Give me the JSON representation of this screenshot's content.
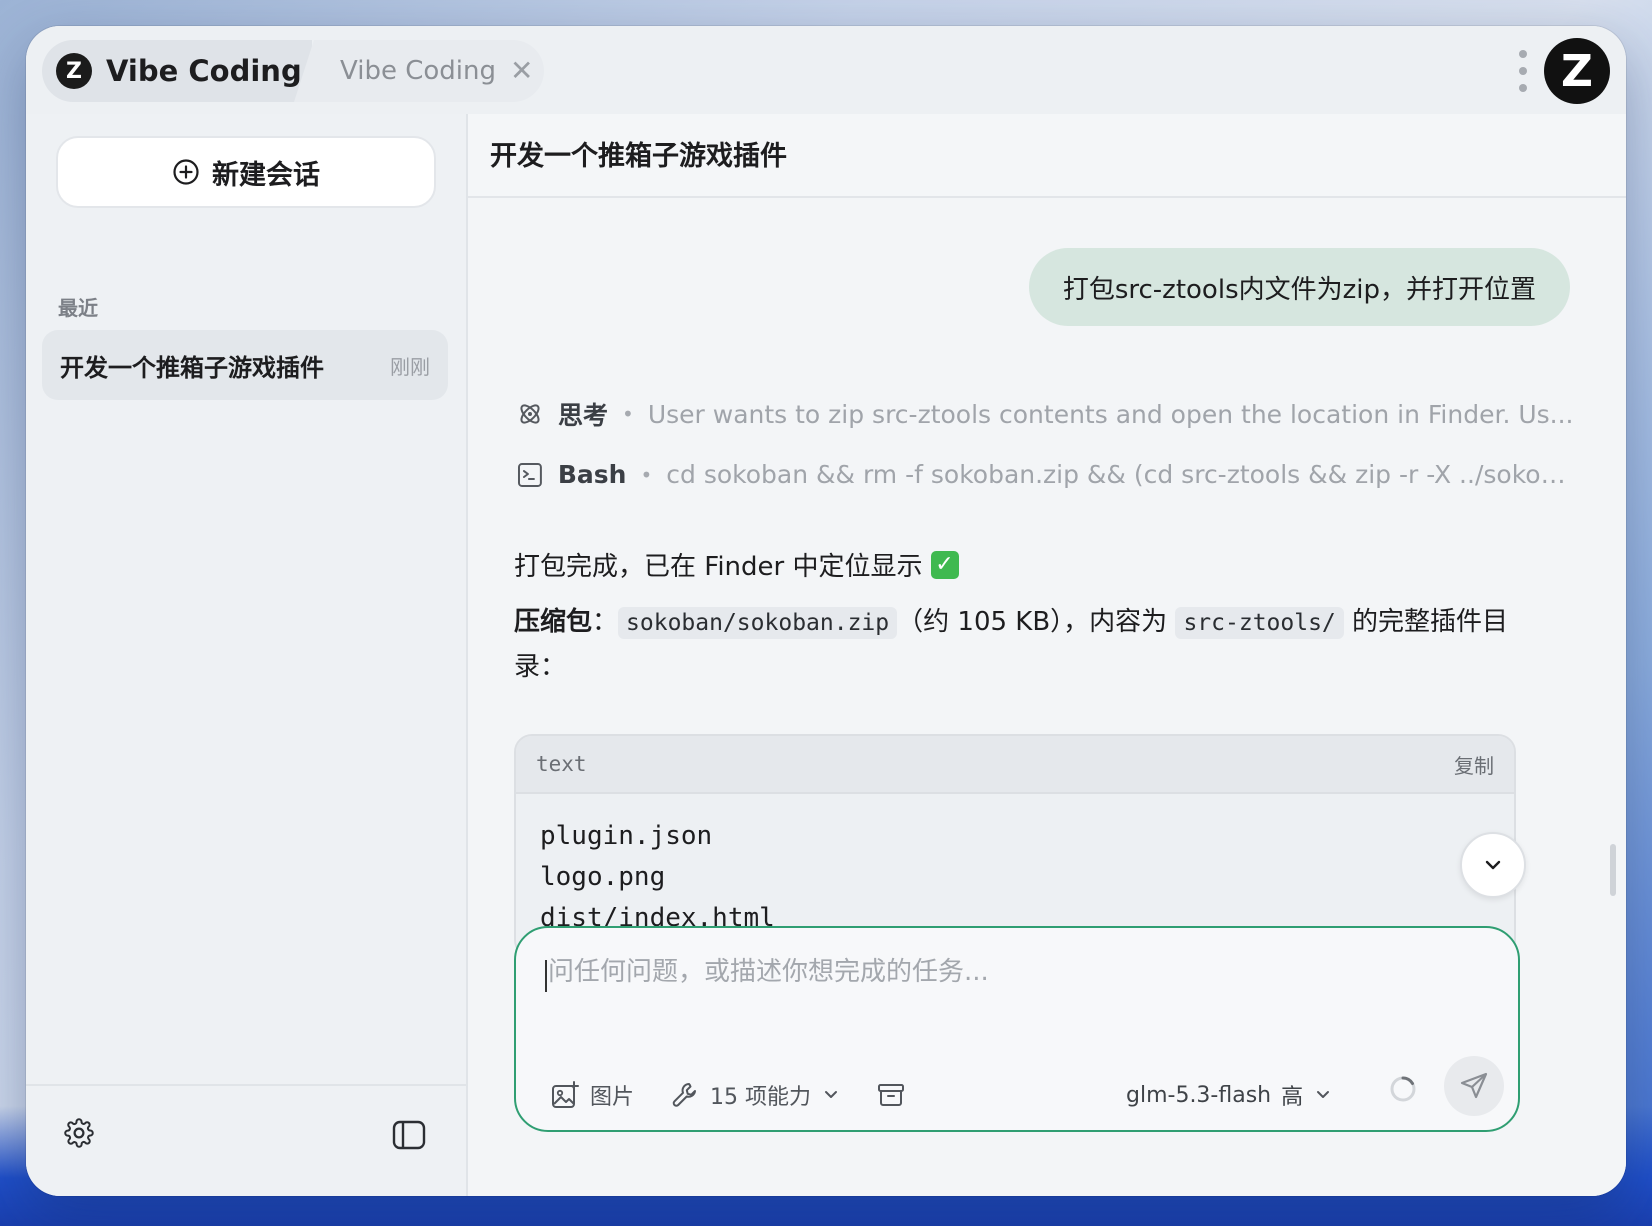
{
  "window": {
    "tabs": [
      {
        "label": "Vibe Coding",
        "active": true,
        "logo": "Z"
      },
      {
        "label": "Vibe Coding",
        "active": false
      }
    ],
    "tab_close_symbol": "✕",
    "app_logo": "Z"
  },
  "sidebar": {
    "new_chat_label": "新建会话",
    "section_label": "最近",
    "sessions": [
      {
        "title": "开发一个推箱子游戏插件",
        "time": "刚刚"
      }
    ],
    "icons": {
      "settings": "gear-icon",
      "toggle": "sidebar-toggle-icon"
    }
  },
  "main": {
    "title": "开发一个推箱子游戏插件",
    "user_message": "打包src-ztools内文件为zip，并打开位置",
    "tool_calls": [
      {
        "name": "思考",
        "desc": "User wants to zip src-ztools contents and open the location in Finder. Us...",
        "icon": "atom-icon"
      },
      {
        "name": "Bash",
        "desc": "cd sokoban && rm -f sokoban.zip && (cd src-ztools && zip -r -X ../sokob...",
        "icon": "terminal-icon"
      }
    ],
    "reply": {
      "line1": "打包完成，已在 Finder 中定位显示",
      "check": "✓",
      "label": "压缩包",
      "colon": "：",
      "path": "sokoban/sokoban.zip",
      "mid": "（约 105 KB），内容为",
      "folder": "src-ztools/",
      "tail": "的完整插件目录："
    },
    "codeblock": {
      "lang": "text",
      "copy_label": "复制",
      "lines": [
        "plugin.json",
        "logo.png",
        "dist/index.html"
      ]
    },
    "composer": {
      "placeholder": "问任何问题，或描述你想完成的任务...",
      "value": "",
      "image_label": "图片",
      "skills_label": "15 项能力",
      "model": "glm-5.3-flash",
      "effort": "高"
    }
  },
  "colors": {
    "accent": "#2f9e72",
    "user_bubble": "#d6e6df",
    "check": "#3fb950"
  }
}
